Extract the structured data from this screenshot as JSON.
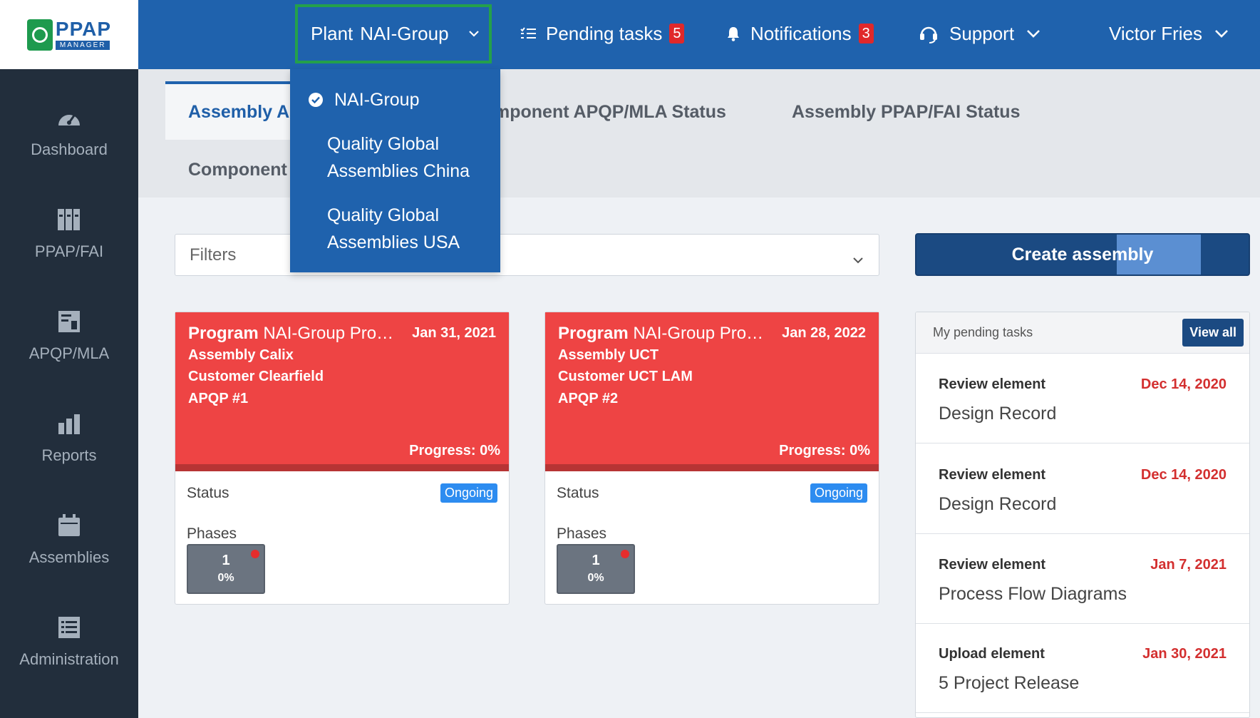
{
  "app": {
    "logo_main": "PPAP",
    "logo_sub": "MANAGER"
  },
  "sidebar": {
    "items": [
      {
        "label": "Dashboard",
        "icon": "dashboard-gauge-icon"
      },
      {
        "label": "PPAP/FAI",
        "icon": "binders-icon"
      },
      {
        "label": "APQP/MLA",
        "icon": "document-chart-icon"
      },
      {
        "label": "Reports",
        "icon": "bar-chart-icon"
      },
      {
        "label": "Assemblies",
        "icon": "calendar-icon"
      },
      {
        "label": "Administration",
        "icon": "list-icon"
      }
    ]
  },
  "topbar": {
    "plant_prefix": "Plant",
    "plant_value": "NAI-Group",
    "pending_tasks_label": "Pending tasks",
    "pending_tasks_count": "5",
    "notifications_label": "Notifications",
    "notifications_count": "3",
    "support_label": "Support",
    "user_name": "Victor Fries"
  },
  "plant_dropdown": {
    "options": [
      {
        "label": "NAI-Group",
        "selected": true
      },
      {
        "line1": "Quality Global",
        "line2": "Assemblies China"
      },
      {
        "line1": "Quality Global",
        "line2": "Assemblies USA"
      }
    ]
  },
  "tabs": {
    "assembly_apqp_visible": "Assembly A",
    "component_apqp_visible": "mponent APQP/MLA Status",
    "assembly_ppap": "Assembly PPAP/FAI Status",
    "component_visible": "Component"
  },
  "filters": {
    "label": "Filters"
  },
  "create_button": "Create assembly",
  "cards": [
    {
      "program_label": "Program",
      "program_name": "NAI-Group Pro…",
      "date": "Jan 31, 2021",
      "assembly": "Assembly Calix",
      "customer": "Customer Clearfield",
      "apqp": "APQP #1",
      "progress": "Progress: 0%",
      "status_label": "Status",
      "status": "Ongoing",
      "phases_label": "Phases",
      "phase_number": "1",
      "phase_percent": "0%"
    },
    {
      "program_label": "Program",
      "program_name": "NAI-Group Pro…",
      "date": "Jan 28, 2022",
      "assembly": "Assembly UCT",
      "customer": "Customer UCT LAM",
      "apqp": "APQP #2",
      "progress": "Progress: 0%",
      "status_label": "Status",
      "status": "Ongoing",
      "phases_label": "Phases",
      "phase_number": "1",
      "phase_percent": "0%"
    }
  ],
  "pending_tasks": {
    "title": "My pending tasks",
    "view_all": "View all",
    "items": [
      {
        "action": "Review element",
        "date": "Dec 14, 2020",
        "element": "Design Record"
      },
      {
        "action": "Review element",
        "date": "Dec 14, 2020",
        "element": "Design Record"
      },
      {
        "action": "Review element",
        "date": "Jan 7, 2021",
        "element": "Process Flow Diagrams"
      },
      {
        "action": "Upload element",
        "date": "Jan 30, 2021",
        "element": "5 Project Release"
      }
    ]
  },
  "colors": {
    "topbar": "#1f62ad",
    "sidebar": "#222e3c",
    "card_header": "#ee4444",
    "selection_outline": "#24a04b",
    "status_badge": "#2d8cf0",
    "task_date": "#d32f2f"
  }
}
